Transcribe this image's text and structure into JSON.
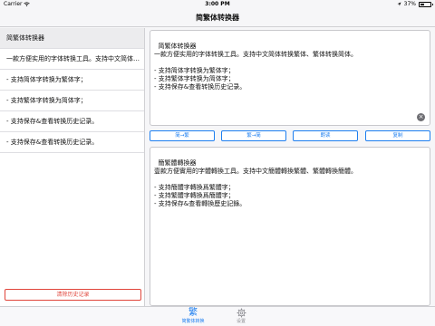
{
  "status_bar": {
    "carrier": "Carrier",
    "wifi_icon": "wifi-icon",
    "time": "3:00 PM",
    "battery_percent": "37%",
    "battery_level": 0.37
  },
  "nav": {
    "title": "简繁体转换器"
  },
  "sidebar": {
    "items": [
      {
        "label": "简繁体转换器"
      },
      {
        "label": "一款方便实用的字体转换工具。支持中文简体转换繁体、繁体转换简体。"
      },
      {
        "label": "- 支持简体字转换为繁体字；"
      },
      {
        "label": "- 支持繁体字转换为简体字；"
      },
      {
        "label": "- 支持保存&查看转换历史记录。"
      },
      {
        "label": "- 支持保存&查看转换历史记录。"
      }
    ],
    "clear_history_label": "清除历史记录"
  },
  "input": {
    "text": "简繁体转换器\n一款方便实用的字体转换工具。支持中文简体转换繁体、繁体转换简体。\n\n- 支持简体字转换为繁体字；\n- 支持繁体字转换为简体字；\n- 支持保存&查看转换历史记录。",
    "clear_icon": "clear-circle-icon"
  },
  "buttons": {
    "to_traditional": "简→繁",
    "to_simplified": "繁→简",
    "read_aloud": "朗读",
    "copy": "复制"
  },
  "output": {
    "text": "簡繁體轉換器\n壹款方便實用的字體轉換工具。支持中文簡體轉換繁體、繁體轉換簡體。\n\n- 支持簡體字轉換爲繁體字；\n- 支持繁體字轉換爲簡體字；\n- 支持保存&查看轉換歷史記錄。"
  },
  "tabs": [
    {
      "icon": "繁",
      "label": "简繁体转换",
      "active": true
    },
    {
      "icon": "gear-icon",
      "label": "设置",
      "active": false
    }
  ],
  "colors": {
    "accent": "#1e7ff0",
    "destructive": "#e0453b"
  }
}
